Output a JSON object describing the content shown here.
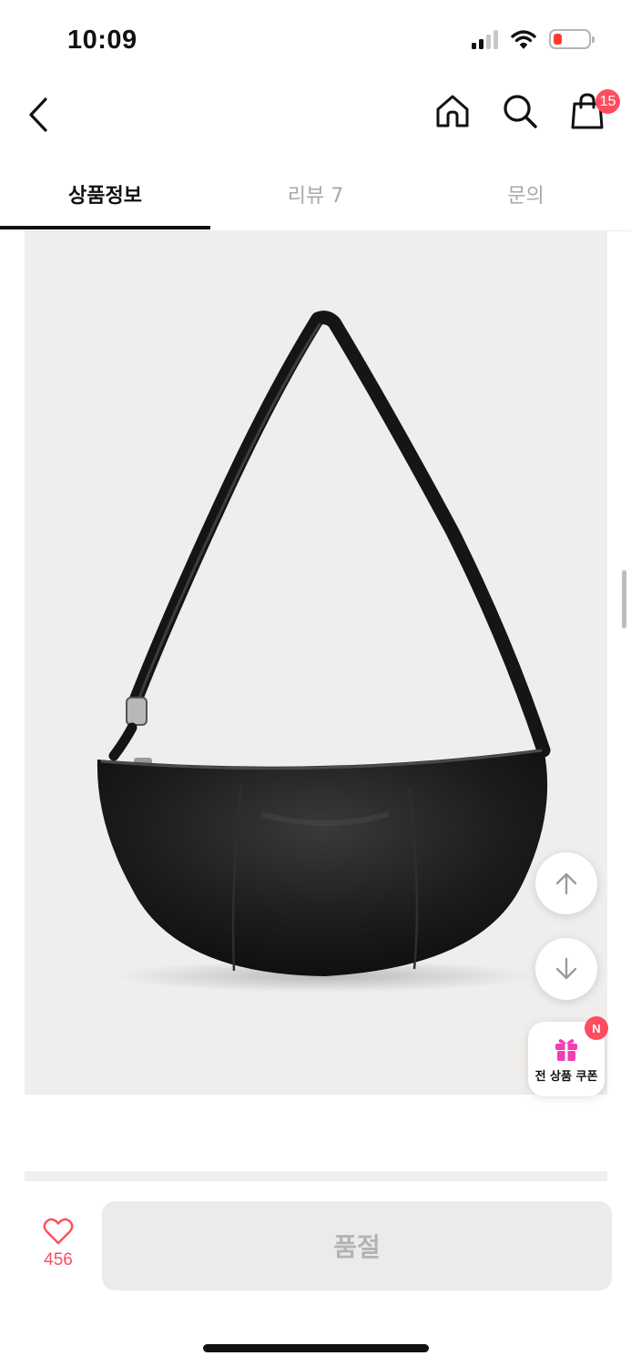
{
  "status_bar": {
    "time": "10:09",
    "icons": [
      "signal-icon",
      "wifi-icon",
      "battery-low-icon"
    ]
  },
  "header": {
    "icons": [
      "back-arrow-icon",
      "home-icon",
      "search-icon",
      "shopping-bag-icon"
    ],
    "cart_count": "15"
  },
  "tabs": [
    {
      "label": "상품정보",
      "active": true
    },
    {
      "label": "리뷰 7",
      "active": false
    },
    {
      "label": "문의",
      "active": false
    }
  ],
  "product_image": {
    "subject": "black leather crescent shoulder bag"
  },
  "floating": {
    "icons": [
      "arrow-up-icon",
      "arrow-down-icon",
      "gift-icon"
    ],
    "coupon_label": "전 상품 쿠폰",
    "coupon_badge": "N"
  },
  "bottom_bar": {
    "like_count": "456",
    "soldout_label": "품절"
  },
  "colors": {
    "accent": "#ff4d5e",
    "coupon_pink": "#f03fb5",
    "image_bg": "#efeeec"
  }
}
